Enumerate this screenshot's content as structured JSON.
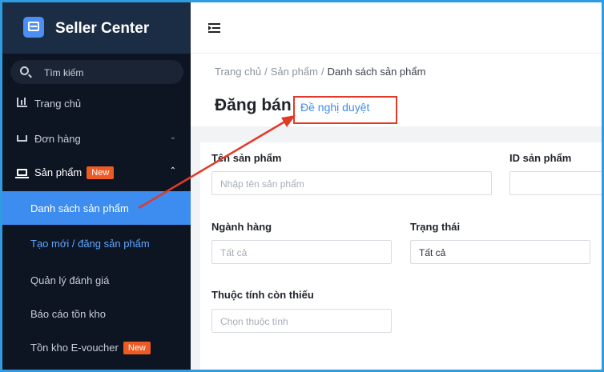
{
  "app": {
    "title": "Seller Center"
  },
  "search": {
    "placeholder": "Tìm kiếm"
  },
  "sidebar": {
    "items": [
      {
        "label": "Trang chủ"
      },
      {
        "label": "Đơn hàng"
      },
      {
        "label": "Sản phẩm",
        "badge": "New"
      }
    ],
    "sub_items": [
      {
        "label": "Danh sách sản phẩm",
        "state": "active"
      },
      {
        "label": "Tạo mới / đăng sản phẩm"
      },
      {
        "label": "Quản lý đánh giá"
      },
      {
        "label": "Báo cáo tồn kho"
      },
      {
        "label": "Tồn kho E-voucher",
        "badge": "New"
      }
    ]
  },
  "breadcrumb": {
    "home": "Trang chủ",
    "products": "Sản phẩm",
    "current": "Danh sách sản phẩm",
    "separator": "/"
  },
  "page": {
    "title": "Đăng bán",
    "suggest_link": "Đề nghị duyệt"
  },
  "form": {
    "product_name": {
      "label": "Tên sản phẩm",
      "placeholder": "Nhập tên sản phẩm"
    },
    "product_id": {
      "label": "ID sản phẩm",
      "value": ""
    },
    "category": {
      "label": "Ngành hàng",
      "placeholder": "Tất cả"
    },
    "status": {
      "label": "Trạng thái",
      "value": "Tất cả"
    },
    "missing_attr": {
      "label": "Thuộc tính còn thiếu",
      "placeholder": "Chọn thuộc tính"
    }
  },
  "colors": {
    "accent": "#3d8cf0",
    "sidebar_bg": "#0d1523",
    "brand_bg": "#1b2c45",
    "badge": "#ee5a24",
    "annotation": "#e03a2a",
    "frame": "#2f9be0"
  },
  "icons": [
    "shop-logo-icon",
    "search-icon",
    "chart-icon",
    "cart-icon",
    "box-icon",
    "chevron-down-icon",
    "chevron-up-icon",
    "menu-fold-icon"
  ]
}
